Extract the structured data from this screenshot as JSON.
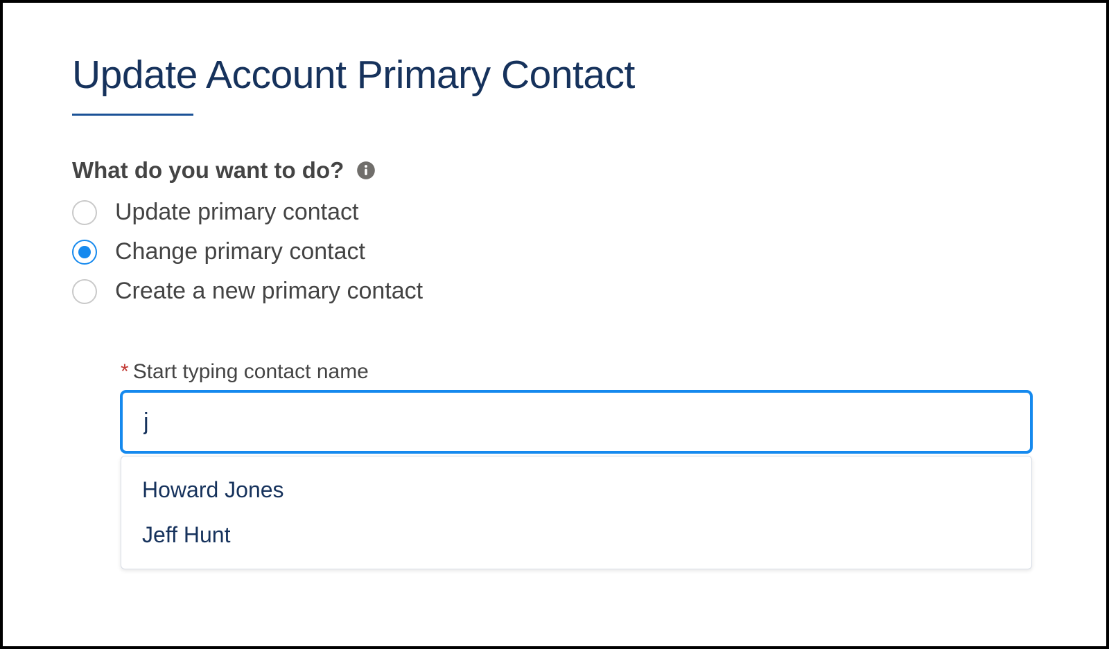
{
  "page": {
    "title": "Update Account Primary Contact"
  },
  "question": {
    "label": "What do you want to do?"
  },
  "options": [
    {
      "label": "Update primary contact",
      "selected": false
    },
    {
      "label": "Change primary contact",
      "selected": true
    },
    {
      "label": "Create a new primary contact",
      "selected": false
    }
  ],
  "contactInput": {
    "requiredMark": "*",
    "label": "Start typing contact name",
    "value": "j"
  },
  "suggestions": [
    "Howard Jones",
    "Jeff Hunt"
  ]
}
